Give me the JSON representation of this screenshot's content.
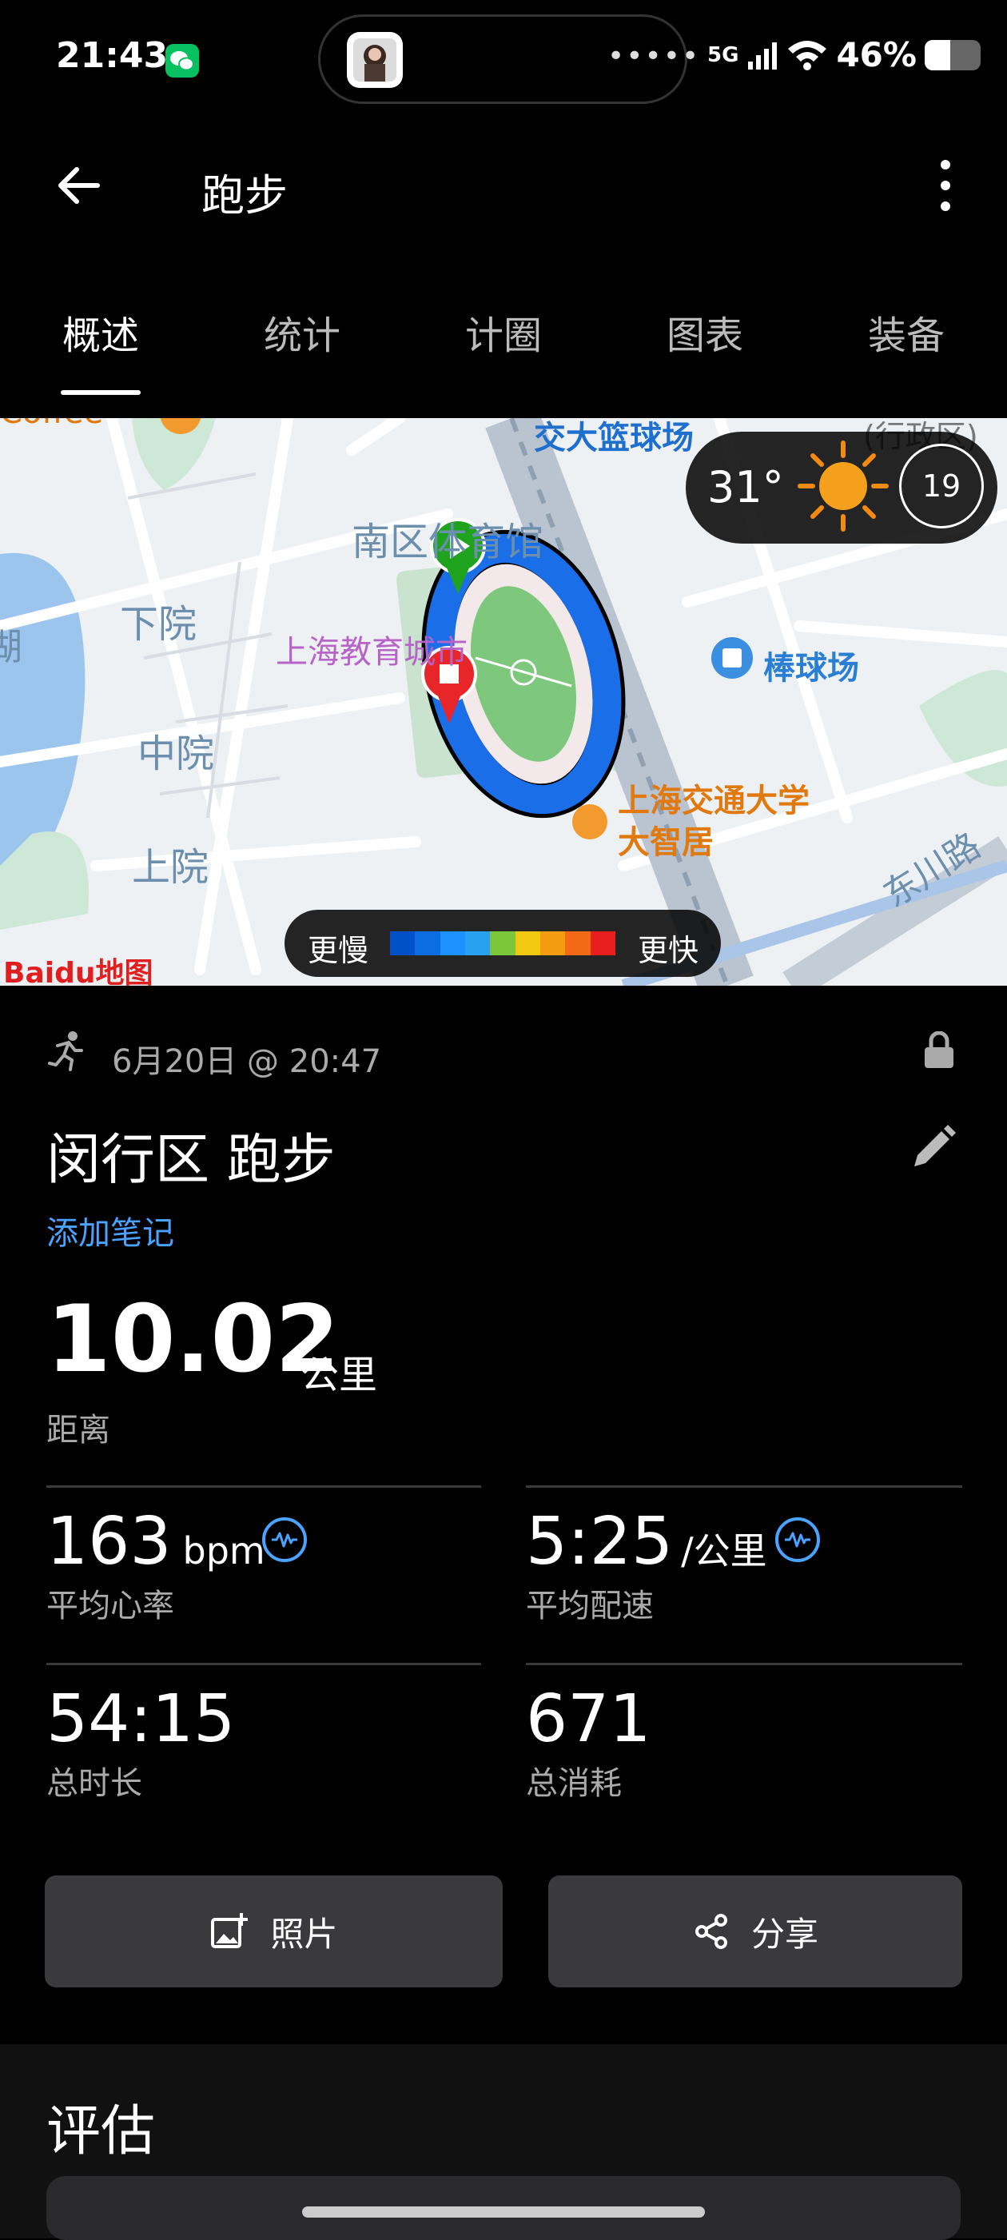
{
  "status_bar": {
    "time": "21:43",
    "network": "5G",
    "battery_percent": "46%",
    "battery_level": 0.46,
    "island_dots": "•••••",
    "icons": [
      "wechat-icon",
      "signal-icon",
      "wifi-icon",
      "battery-icon"
    ]
  },
  "header": {
    "title": "跑步",
    "icons": [
      "back-arrow-icon",
      "more-vertical-icon"
    ]
  },
  "tabs": [
    {
      "label": "概述",
      "active": true
    },
    {
      "label": "统计",
      "active": false
    },
    {
      "label": "计圈",
      "active": false
    },
    {
      "label": "图表",
      "active": false
    },
    {
      "label": "装备",
      "active": false
    }
  ],
  "map": {
    "labels": {
      "top_court": "交大篮球场",
      "gym": "南区体育馆",
      "xiayuan": "下院",
      "edu_city": "上海教育城市",
      "zhongyuan": "中院",
      "shangyuan": "上院",
      "baseball": "棒球场",
      "zhiju": "上海交通大学大智居",
      "road": "东川路",
      "lake": "湖",
      "coffee": "Coffee",
      "district": "(行政区)"
    },
    "weather": {
      "temperature": "31°",
      "uv_index": "19"
    },
    "legend": {
      "slow": "更慢",
      "fast": "更快",
      "colors": [
        "#0050c8",
        "#0a6ee0",
        "#1e90ff",
        "#2aa0f0",
        "#7cc63a",
        "#f2c811",
        "#f59b12",
        "#f26a16",
        "#e81f1f"
      ]
    },
    "watermark": "Baidu地图",
    "colors": {
      "route": "#1a6fe8",
      "start_pin": "#1fa31f",
      "end_pin": "#e8262a"
    }
  },
  "activity": {
    "date": "6月20日 @ 20:47",
    "title": "闵行区 跑步",
    "add_note": "添加笔记",
    "distance": {
      "value": "10.02",
      "unit": "公里",
      "label": "距离"
    },
    "stats": [
      {
        "value": "163",
        "unit": "bpm",
        "label": "平均心率",
        "has_wave_icon": true
      },
      {
        "value": "5:25",
        "unit": "/公里",
        "label": "平均配速",
        "has_wave_icon": true
      },
      {
        "value": "54:15",
        "unit": "",
        "label": "总时长",
        "has_wave_icon": false
      },
      {
        "value": "671",
        "unit": "",
        "label": "总消耗",
        "has_wave_icon": false
      }
    ]
  },
  "buttons": {
    "photo": "照片",
    "share": "分享"
  },
  "evaluation": {
    "title": "评估"
  },
  "colors": {
    "accent": "#4aa3ff",
    "background": "#000000",
    "button": "#3a3a3c"
  }
}
